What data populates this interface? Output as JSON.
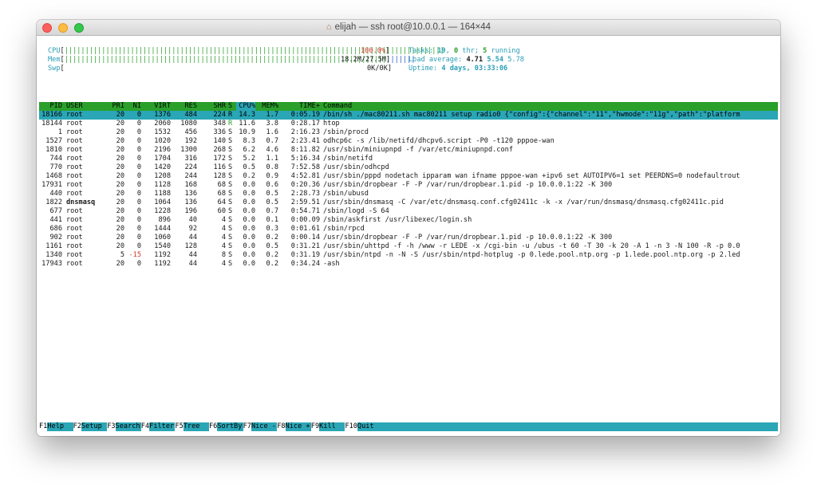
{
  "window": {
    "title": "elijah — ssh root@10.0.0.1 — 164×44",
    "home_icon": "home-icon"
  },
  "meters": {
    "cpu": {
      "label": "CPU",
      "bar_green": "||||||||||||||||||||||||||||||||||||||||||||||||||||||||||||||||||||||||||||||||||||||||||||",
      "text": "100.0%"
    },
    "mem": {
      "label": "Mem",
      "bar_green": "||||||||||||||||||||||||||||||||||||||||||||||||||||||||||||||||||||||||||||||",
      "bar_blue": "|||||||",
      "text": "18.2M/27.5M"
    },
    "swp": {
      "label": "Swp",
      "text": "0K/0K"
    }
  },
  "stats": {
    "tasks_label": "Tasks: ",
    "tasks": "19",
    "thr_sep": ", ",
    "thr": "0",
    "thr_label": " thr; ",
    "running": "5",
    "running_label": " running",
    "load_label": "Load average: ",
    "load1": "4.71",
    "load5": "5.54",
    "load15": "5.78",
    "uptime_label": "Uptime: ",
    "uptime": "4 days, 03:33:06"
  },
  "columns": [
    "PID",
    "USER",
    "PRI",
    "NI",
    "VIRT",
    "RES",
    "SHR",
    "S",
    "CPU%",
    "MEM%",
    "TIME+",
    "Command"
  ],
  "processes": [
    {
      "pid": "18166",
      "user": "root",
      "pri": "20",
      "ni": "0",
      "virt": "1376",
      "res": "484",
      "shr": "224",
      "s": "R",
      "cpu": "14.3",
      "mem": "1.7",
      "time": "0:05.19",
      "cmd": "/bin/sh ./mac80211.sh mac80211 setup radio0 {\"config\":{\"channel\":\"11\",\"hwmode\":\"11g\",\"path\":\"platform"
    },
    {
      "pid": "18144",
      "user": "root",
      "pri": "20",
      "ni": "0",
      "virt": "2060",
      "res": "1080",
      "shr": "348",
      "s": "R",
      "cpu": "11.6",
      "mem": "3.8",
      "time": "0:28.17",
      "cmd": "htop"
    },
    {
      "pid": "1",
      "user": "root",
      "pri": "20",
      "ni": "0",
      "virt": "1532",
      "res": "456",
      "shr": "336",
      "s": "S",
      "cpu": "10.9",
      "mem": "1.6",
      "time": "2:16.23",
      "cmd": "/sbin/procd"
    },
    {
      "pid": "1527",
      "user": "root",
      "pri": "20",
      "ni": "0",
      "virt": "1020",
      "res": "192",
      "shr": "140",
      "s": "S",
      "cpu": "8.3",
      "mem": "0.7",
      "time": "2:23.41",
      "cmd": "odhcp6c -s /lib/netifd/dhcpv6.script -P0 -t120 pppoe-wan"
    },
    {
      "pid": "1810",
      "user": "root",
      "pri": "20",
      "ni": "0",
      "virt": "2196",
      "res": "1300",
      "shr": "268",
      "s": "S",
      "cpu": "6.2",
      "mem": "4.6",
      "time": "8:11.82",
      "cmd": "/usr/sbin/miniupnpd -f /var/etc/miniupnpd.conf"
    },
    {
      "pid": "744",
      "user": "root",
      "pri": "20",
      "ni": "0",
      "virt": "1704",
      "res": "316",
      "shr": "172",
      "s": "S",
      "cpu": "5.2",
      "mem": "1.1",
      "time": "5:16.34",
      "cmd": "/sbin/netifd"
    },
    {
      "pid": "770",
      "user": "root",
      "pri": "20",
      "ni": "0",
      "virt": "1420",
      "res": "224",
      "shr": "116",
      "s": "S",
      "cpu": "0.5",
      "mem": "0.8",
      "time": "7:52.58",
      "cmd": "/usr/sbin/odhcpd"
    },
    {
      "pid": "1468",
      "user": "root",
      "pri": "20",
      "ni": "0",
      "virt": "1208",
      "res": "244",
      "shr": "128",
      "s": "S",
      "cpu": "0.2",
      "mem": "0.9",
      "time": "4:52.81",
      "cmd": "/usr/sbin/pppd nodetach ipparam wan ifname pppoe-wan +ipv6 set AUTOIPV6=1 set PEERDNS=0 nodefaultrout"
    },
    {
      "pid": "17931",
      "user": "root",
      "pri": "20",
      "ni": "0",
      "virt": "1128",
      "res": "168",
      "shr": "68",
      "s": "S",
      "cpu": "0.0",
      "mem": "0.6",
      "time": "0:20.36",
      "cmd": "/usr/sbin/dropbear -F -P /var/run/dropbear.1.pid -p 10.0.0.1:22 -K 300"
    },
    {
      "pid": "440",
      "user": "root",
      "pri": "20",
      "ni": "0",
      "virt": "1188",
      "res": "136",
      "shr": "68",
      "s": "S",
      "cpu": "0.0",
      "mem": "0.5",
      "time": "2:28.73",
      "cmd": "/sbin/ubusd"
    },
    {
      "pid": "1822",
      "user": "dnsmasq",
      "pri": "20",
      "ni": "0",
      "virt": "1064",
      "res": "136",
      "shr": "64",
      "s": "S",
      "cpu": "0.0",
      "mem": "0.5",
      "time": "2:59.51",
      "cmd": "/usr/sbin/dnsmasq -C /var/etc/dnsmasq.conf.cfg02411c -k -x /var/run/dnsmasq/dnsmasq.cfg02411c.pid"
    },
    {
      "pid": "677",
      "user": "root",
      "pri": "20",
      "ni": "0",
      "virt": "1228",
      "res": "196",
      "shr": "60",
      "s": "S",
      "cpu": "0.0",
      "mem": "0.7",
      "time": "0:54.71",
      "cmd": "/sbin/logd -S 64"
    },
    {
      "pid": "441",
      "user": "root",
      "pri": "20",
      "ni": "0",
      "virt": "896",
      "res": "40",
      "shr": "4",
      "s": "S",
      "cpu": "0.0",
      "mem": "0.1",
      "time": "0:00.09",
      "cmd": "/sbin/askfirst /usr/libexec/login.sh"
    },
    {
      "pid": "686",
      "user": "root",
      "pri": "20",
      "ni": "0",
      "virt": "1444",
      "res": "92",
      "shr": "4",
      "s": "S",
      "cpu": "0.0",
      "mem": "0.3",
      "time": "0:01.61",
      "cmd": "/sbin/rpcd"
    },
    {
      "pid": "902",
      "user": "root",
      "pri": "20",
      "ni": "0",
      "virt": "1060",
      "res": "44",
      "shr": "4",
      "s": "S",
      "cpu": "0.0",
      "mem": "0.2",
      "time": "0:00.14",
      "cmd": "/usr/sbin/dropbear -F -P /var/run/dropbear.1.pid -p 10.0.0.1:22 -K 300"
    },
    {
      "pid": "1161",
      "user": "root",
      "pri": "20",
      "ni": "0",
      "virt": "1540",
      "res": "128",
      "shr": "4",
      "s": "S",
      "cpu": "0.0",
      "mem": "0.5",
      "time": "0:31.21",
      "cmd": "/usr/sbin/uhttpd -f -h /www -r LEDE -x /cgi-bin -u /ubus -t 60 -T 30 -k 20 -A 1 -n 3 -N 100 -R -p 0.0"
    },
    {
      "pid": "1340",
      "user": "root",
      "pri": "5",
      "ni": "-15",
      "virt": "1192",
      "res": "44",
      "shr": "8",
      "s": "S",
      "cpu": "0.0",
      "mem": "0.2",
      "time": "0:31.19",
      "cmd": "/usr/sbin/ntpd -n -N -S /usr/sbin/ntpd-hotplug -p 0.lede.pool.ntp.org -p 1.lede.pool.ntp.org -p 2.led"
    },
    {
      "pid": "17943",
      "user": "root",
      "pri": "20",
      "ni": "0",
      "virt": "1192",
      "res": "44",
      "shr": "4",
      "s": "S",
      "cpu": "0.0",
      "mem": "0.2",
      "time": "0:34.24",
      "cmd": "-ash"
    }
  ],
  "function_keys": [
    {
      "num": "F1",
      "label": "Help  "
    },
    {
      "num": "F2",
      "label": "Setup "
    },
    {
      "num": "F3",
      "label": "Search"
    },
    {
      "num": "F4",
      "label": "Filter"
    },
    {
      "num": "F5",
      "label": "Tree  "
    },
    {
      "num": "F6",
      "label": "SortBy"
    },
    {
      "num": "F7",
      "label": "Nice -"
    },
    {
      "num": "F8",
      "label": "Nice +"
    },
    {
      "num": "F9",
      "label": "Kill  "
    },
    {
      "num": "F10",
      "label": "Quit  "
    }
  ],
  "colors": {
    "header_bg": "#2aa02a",
    "selected_bg": "#2aa6b6",
    "sort_col_bg": "#2aa6b6",
    "accent_cyan": "#2a9fb6"
  }
}
